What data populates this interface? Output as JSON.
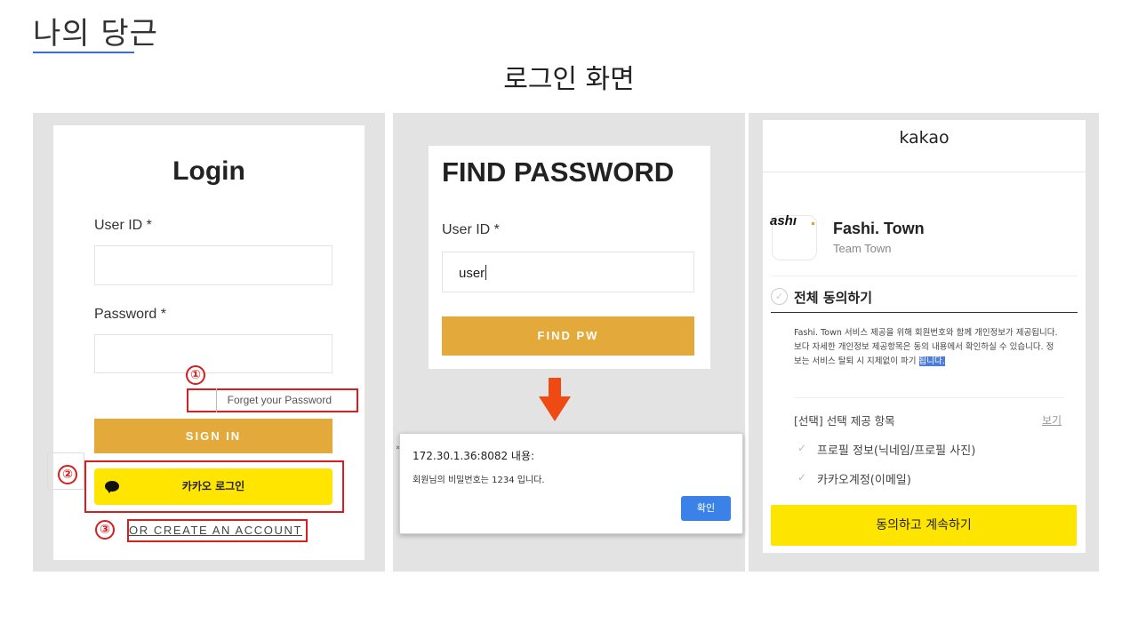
{
  "slide": {
    "title": "나의 당근",
    "subtitle": "로그인 화면"
  },
  "login": {
    "title": "Login",
    "user_id_label": "User ID *",
    "password_label": "Password *",
    "forgot_label": "Forget your Password",
    "signin_label": "SIGN IN",
    "kakao_label": "카카오 로그인",
    "create_label": "OR CREATE AN ACCOUNT",
    "markers": [
      "①",
      "②",
      "③"
    ],
    "accent_color": "#e3a93a",
    "kakao_color": "#ffe500",
    "highlight_color": "#d81e1e"
  },
  "find_password": {
    "title": "FIND PASSWORD",
    "user_id_label": "User ID *",
    "user_id_value": "user",
    "button_label": "FIND PW",
    "arrow_icon": "arrow-down-icon"
  },
  "alert": {
    "title": "172.30.1.36:8082 내용:",
    "message": "회원님의 비밀번호는 1234 입니다.",
    "ok_label": "확인",
    "edge_char": "»"
  },
  "kakao_consent": {
    "logo": "kakao",
    "app_icon_text": "ashı",
    "app_name": "Fashi. Town",
    "app_sub": "Team Town",
    "agree_all": "전체 동의하기",
    "description": "Fashi. Town 서비스 제공을 위해 회원번호와 함께 개인정보가 제공됩니다. 보다 자세한 개인정보 제공항목은 동의 내용에서 확인하실 수 있습니다. 정보는 서비스 탈퇴 시 지체없이 파기",
    "description_highlight": "됩니다.",
    "optional_title": "[선택] 선택 제공 항목",
    "view_label": "보기",
    "optional_items": [
      "프로필 정보(닉네임/프로필 사진)",
      "카카오계정(이메일)"
    ],
    "continue_label": "동의하고 계속하기"
  }
}
